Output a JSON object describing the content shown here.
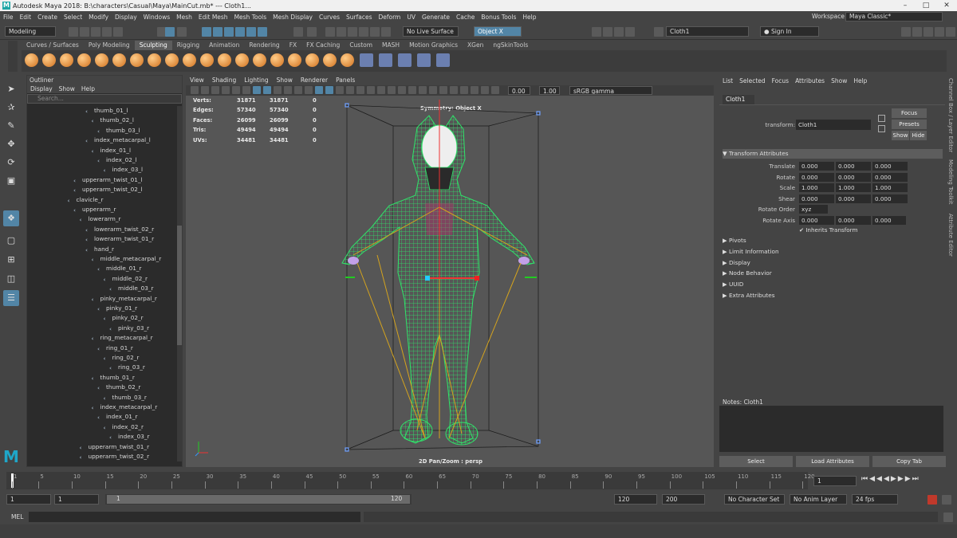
{
  "window": {
    "title": "Autodesk Maya 2018: B:\\characters\\Casual\\Maya\\MainCut.mb*   ---   Cloth1..."
  },
  "menubar": {
    "items": [
      "File",
      "Edit",
      "Create",
      "Select",
      "Modify",
      "Display",
      "Windows",
      "Mesh",
      "Edit Mesh",
      "Mesh Tools",
      "Mesh Display",
      "Curves",
      "Surfaces",
      "Deform",
      "UV",
      "Generate",
      "Cache",
      "Bonus Tools",
      "Help"
    ],
    "workspace_label": "Workspace :",
    "workspace_value": "Maya Classic*"
  },
  "status": {
    "mode": "Modeling",
    "live_surface": "No Live Surface",
    "symmetry": "Object X",
    "object_field": "Cloth1",
    "sign_in": "Sign In"
  },
  "shelf": {
    "tabs": [
      "Curves / Surfaces",
      "Poly Modeling",
      "Sculpting",
      "Rigging",
      "Animation",
      "Rendering",
      "FX",
      "FX Caching",
      "Custom",
      "MASH",
      "Motion Graphics",
      "XGen",
      "ngSkinTools"
    ],
    "active_tab": "Sculpting"
  },
  "outliner": {
    "title": "Outliner",
    "menu": [
      "Display",
      "Show",
      "Help"
    ],
    "search_placeholder": "Search...",
    "rows": [
      {
        "label": "thumb_01_l",
        "depth": 6
      },
      {
        "label": "thumb_02_l",
        "depth": 7
      },
      {
        "label": "thumb_03_l",
        "depth": 8
      },
      {
        "label": "index_metacarpal_l",
        "depth": 6
      },
      {
        "label": "index_01_l",
        "depth": 7
      },
      {
        "label": "index_02_l",
        "depth": 8
      },
      {
        "label": "index_03_l",
        "depth": 9
      },
      {
        "label": "upperarm_twist_01_l",
        "depth": 4
      },
      {
        "label": "upperarm_twist_02_l",
        "depth": 4
      },
      {
        "label": "clavicle_r",
        "depth": 3
      },
      {
        "label": "upperarm_r",
        "depth": 4
      },
      {
        "label": "lowerarm_r",
        "depth": 5
      },
      {
        "label": "lowerarm_twist_02_r",
        "depth": 6
      },
      {
        "label": "lowerarm_twist_01_r",
        "depth": 6
      },
      {
        "label": "hand_r",
        "depth": 6
      },
      {
        "label": "middle_metacarpal_r",
        "depth": 7
      },
      {
        "label": "middle_01_r",
        "depth": 8
      },
      {
        "label": "middle_02_r",
        "depth": 9
      },
      {
        "label": "middle_03_r",
        "depth": 10
      },
      {
        "label": "pinky_metacarpal_r",
        "depth": 7
      },
      {
        "label": "pinky_01_r",
        "depth": 8
      },
      {
        "label": "pinky_02_r",
        "depth": 9
      },
      {
        "label": "pinky_03_r",
        "depth": 10
      },
      {
        "label": "ring_metacarpal_r",
        "depth": 7
      },
      {
        "label": "ring_01_r",
        "depth": 8
      },
      {
        "label": "ring_02_r",
        "depth": 9
      },
      {
        "label": "ring_03_r",
        "depth": 10
      },
      {
        "label": "thumb_01_r",
        "depth": 7
      },
      {
        "label": "thumb_02_r",
        "depth": 8
      },
      {
        "label": "thumb_03_r",
        "depth": 9
      },
      {
        "label": "index_metacarpal_r",
        "depth": 7
      },
      {
        "label": "index_01_r",
        "depth": 8
      },
      {
        "label": "index_02_r",
        "depth": 9
      },
      {
        "label": "index_03_r",
        "depth": 10
      },
      {
        "label": "upperarm_twist_01_r",
        "depth": 5
      },
      {
        "label": "upperarm_twist_02_r",
        "depth": 5
      }
    ]
  },
  "viewport": {
    "menu": [
      "View",
      "Shading",
      "Lighting",
      "Show",
      "Renderer",
      "Panels"
    ],
    "exposure": "0.00",
    "gamma": "1.00",
    "color_space": "sRGB gamma",
    "symmetry_label": "Symmetry: Object X",
    "camera_label": "2D Pan/Zoom : persp",
    "hud": [
      {
        "label": "Verts:",
        "a": "31871",
        "b": "31871",
        "c": "0"
      },
      {
        "label": "Edges:",
        "a": "57340",
        "b": "57340",
        "c": "0"
      },
      {
        "label": "Faces:",
        "a": "26099",
        "b": "26099",
        "c": "0"
      },
      {
        "label": "Tris:",
        "a": "49494",
        "b": "49494",
        "c": "0"
      },
      {
        "label": "UVs:",
        "a": "34481",
        "b": "34481",
        "c": "0"
      }
    ]
  },
  "attribute_editor": {
    "menu": [
      "List",
      "Selected",
      "Focus",
      "Attributes",
      "Show",
      "Help"
    ],
    "tab": "Cloth1",
    "transform_label": "transform:",
    "transform_value": "Cloth1",
    "focus": "Focus",
    "presets": "Presets",
    "show": "Show",
    "hide": "Hide",
    "section_transform": "Transform Attributes",
    "attrs": [
      {
        "name": "Translate",
        "v": [
          "0.000",
          "0.000",
          "0.000"
        ]
      },
      {
        "name": "Rotate",
        "v": [
          "0.000",
          "0.000",
          "0.000"
        ]
      },
      {
        "name": "Scale",
        "v": [
          "1.000",
          "1.000",
          "1.000"
        ]
      },
      {
        "name": "Shear",
        "v": [
          "0.000",
          "0.000",
          "0.000"
        ]
      }
    ],
    "rotate_order_label": "Rotate Order",
    "rotate_order": "xyz",
    "rotate_axis_label": "Rotate Axis",
    "rotate_axis": [
      "0.000",
      "0.000",
      "0.000"
    ],
    "inherits": "Inherits Transform",
    "sections": [
      "Pivots",
      "Limit Information",
      "Display",
      "Node Behavior",
      "UUID",
      "Extra Attributes"
    ],
    "notes": "Notes:  Cloth1",
    "bottom_buttons": [
      "Select",
      "Load Attributes",
      "Copy Tab"
    ]
  },
  "side_tabs": [
    "Channel Box / Layer Editor",
    "Modeling Toolkit",
    "Attribute Editor"
  ],
  "timeline": {
    "ticks": [
      "1",
      "5",
      "10",
      "15",
      "20",
      "25",
      "30",
      "35",
      "40",
      "45",
      "50",
      "55",
      "60",
      "65",
      "70",
      "75",
      "80",
      "85",
      "90",
      "95",
      "100",
      "105",
      "110",
      "115",
      "120"
    ],
    "current_frame": "1",
    "range_start": "1",
    "playback_start": "1",
    "slider_start": "1",
    "slider_end": "120",
    "playback_end": "120",
    "range_end": "200",
    "char_set": "No Character Set",
    "anim_layer": "No Anim Layer",
    "fps": "24 fps"
  },
  "cmd": {
    "label": "MEL"
  }
}
